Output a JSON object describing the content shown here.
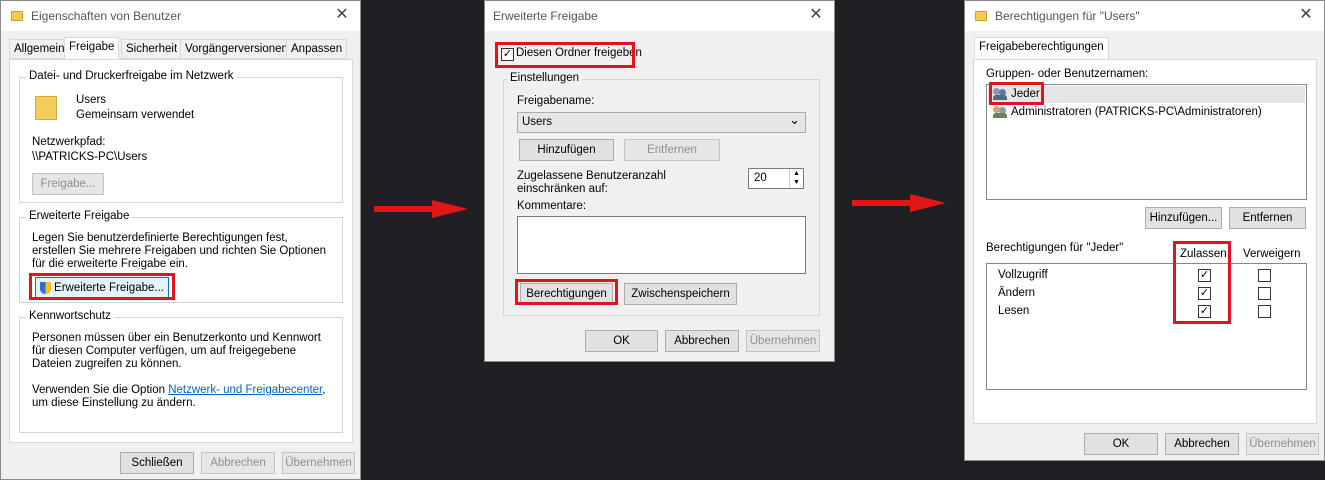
{
  "dialog1": {
    "title": "Eigenschaften von Benutzer",
    "tabs": [
      "Allgemein",
      "Freigabe",
      "Sicherheit",
      "Vorgängerversionen",
      "Anpassen"
    ],
    "network_group_title": "Datei- und Druckerfreigabe im Netzwerk",
    "folder_name": "Users",
    "folder_status": "Gemeinsam verwendet",
    "network_path_label": "Netzwerkpfad:",
    "network_path": "\\\\PATRICKS-PC\\Users",
    "share_button": "Freigabe...",
    "advanced_group_title": "Erweiterte Freigabe",
    "advanced_description": "Legen Sie benutzerdefinierte Berechtigungen fest, erstellen Sie mehrere Freigaben und richten Sie Optionen für die erweiterte Freigabe ein.",
    "advanced_button": "Erweiterte Freigabe...",
    "password_group_title": "Kennwortschutz",
    "password_text": "Personen müssen über ein Benutzerkonto und Kennwort für diesen Computer verfügen, um auf freigegebene Dateien zugreifen zu können.",
    "settings_text_before": "Verwenden Sie die Option ",
    "settings_link": "Netzwerk- und Freigabecenter",
    "settings_text_after": ", um diese Einstellung zu ändern.",
    "close_button": "Schließen",
    "cancel_button": "Abbrechen",
    "apply_button": "Übernehmen"
  },
  "dialog2": {
    "title": "Erweiterte Freigabe",
    "share_checkbox_label": "Diesen Ordner freigeben",
    "share_checked": true,
    "settings_group_title": "Einstellungen",
    "share_name_label": "Freigabename:",
    "share_name_value": "Users",
    "add_button": "Hinzufügen",
    "remove_button": "Entfernen",
    "user_limit_label": "Zugelassene Benutzeranzahl einschränken auf:",
    "user_limit_value": "20",
    "comments_label": "Kommentare:",
    "comments_value": "",
    "permissions_button": "Berechtigungen",
    "cache_button": "Zwischenspeichern",
    "ok_button": "OK",
    "cancel_button": "Abbrechen",
    "apply_button": "Übernehmen"
  },
  "dialog3": {
    "title": "Berechtigungen für \"Users\"",
    "tab": "Freigabeberechtigungen",
    "groups_label": "Gruppen- oder Benutzernamen:",
    "users": [
      {
        "name": "Jeder",
        "icon": "users-group-icon",
        "selected": true
      },
      {
        "name": "Administratoren (PATRICKS-PC\\Administratoren)",
        "icon": "users-group-icon",
        "selected": false
      }
    ],
    "add_button": "Hinzufügen...",
    "remove_button": "Entfernen",
    "permissions_for_label": "Berechtigungen für \"Jeder\"",
    "allow_header": "Zulassen",
    "deny_header": "Verweigern",
    "permissions": [
      {
        "name": "Vollzugriff",
        "allow": true,
        "deny": false
      },
      {
        "name": "Ändern",
        "allow": true,
        "deny": false
      },
      {
        "name": "Lesen",
        "allow": true,
        "deny": false
      }
    ],
    "ok_button": "OK",
    "cancel_button": "Abbrechen",
    "apply_button": "Übernehmen"
  },
  "colors": {
    "highlight_red": "#e1141b",
    "arrow_red": "#e11717",
    "background": "#1f1f24",
    "link": "#0066cc"
  },
  "glyphs": {
    "close": "✕",
    "check": "✓",
    "chevron_down": "⌄",
    "spin_up": "▲",
    "spin_down": "▼"
  }
}
